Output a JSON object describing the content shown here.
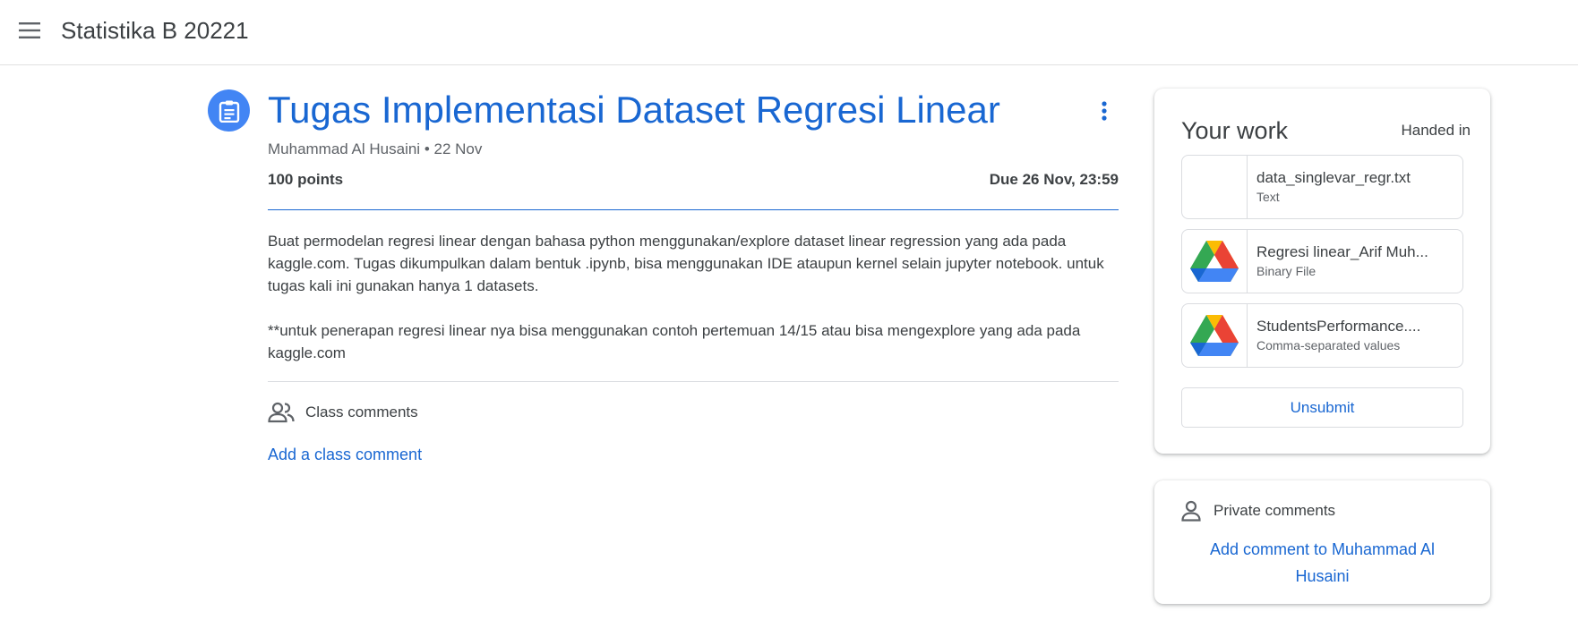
{
  "header": {
    "menu_icon": "hamburger-menu-icon",
    "class_name": "Statistika B 20221"
  },
  "assignment": {
    "icon": "assignment-clipboard-icon",
    "title": "Tugas Implementasi Dataset Regresi Linear",
    "author": "Muhammad Al Husaini",
    "posted": "22 Nov",
    "meta_separator": "•",
    "points": "100 points",
    "due": "Due 26 Nov, 23:59",
    "description": [
      "Buat permodelan regresi linear dengan bahasa python menggunakan/explore dataset linear regression yang ada pada kaggle.com. Tugas dikumpulkan dalam bentuk .ipynb, bisa menggunakan IDE ataupun kernel selain jupyter notebook. untuk tugas kali ini gunakan hanya 1 datasets.",
      "**untuk penerapan regresi linear nya bisa menggunakan contoh pertemuan 14/15 atau bisa mengexplore yang ada pada kaggle.com"
    ],
    "more_icon": "more-vert-icon"
  },
  "class_comments": {
    "icon": "people-icon",
    "heading": "Class comments",
    "add_label": "Add a class comment"
  },
  "your_work": {
    "title": "Your work",
    "status": "Handed in",
    "attachments": [
      {
        "name": "data_singlevar_regr.txt",
        "type": "Text",
        "icon": "blank-thumbnail"
      },
      {
        "name": "Regresi linear_Arif Muh...",
        "type": "Binary File",
        "icon": "google-drive-icon"
      },
      {
        "name": "StudentsPerformance....",
        "type": "Comma-separated values",
        "icon": "google-drive-icon"
      }
    ],
    "unsubmit_label": "Unsubmit"
  },
  "private_comments": {
    "icon": "person-icon",
    "heading": "Private comments",
    "add_label": "Add comment to Muhammad Al Husaini"
  },
  "colors": {
    "accent_blue": "#1967d2",
    "icon_blue": "#4285f4",
    "text": "#3c4043",
    "secondary_text": "#5f6368",
    "divider": "#dadce0"
  }
}
